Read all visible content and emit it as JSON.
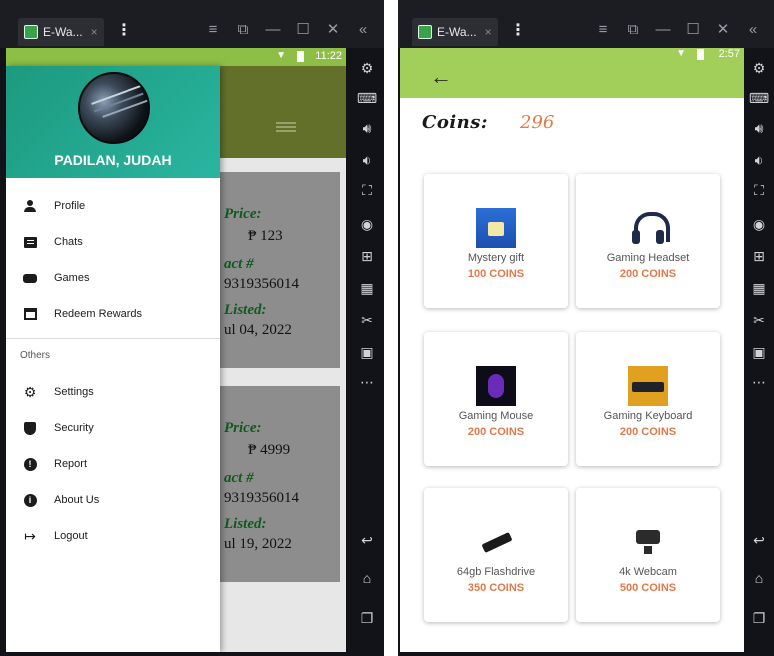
{
  "left_window": {
    "tab_title": "E-Wa...",
    "tab_close": "×",
    "status_time": "11:22",
    "drawer": {
      "user_name": "PADILAN, JUDAH",
      "items": [
        {
          "label": "Profile",
          "icon": "person-icon"
        },
        {
          "label": "Chats",
          "icon": "chat-icon"
        },
        {
          "label": "Games",
          "icon": "gamepad-icon"
        },
        {
          "label": "Redeem Rewards",
          "icon": "gift-icon"
        }
      ],
      "section_label": "Others",
      "other_items": [
        {
          "label": "Settings",
          "icon": "gear-icon"
        },
        {
          "label": "Security",
          "icon": "shield-icon"
        },
        {
          "label": "Report",
          "icon": "alert-icon"
        },
        {
          "label": "About Us",
          "icon": "info-icon"
        },
        {
          "label": "Logout",
          "icon": "logout-icon"
        }
      ]
    },
    "background_listings": [
      {
        "price_label": "Price:",
        "price": "₱ 123",
        "contact_label": "act #",
        "contact": "9319356014",
        "listed_label": "Listed:",
        "listed": "ul 04, 2022"
      },
      {
        "price_label": "Price:",
        "price": "₱ 4999",
        "contact_label": "act #",
        "contact": "9319356014",
        "listed_label": "Listed:",
        "listed": "ul 19, 2022"
      }
    ]
  },
  "right_window": {
    "tab_title": "E-Wa...",
    "tab_close": "×",
    "status_time": "2:57",
    "back_icon": "back-arrow-icon",
    "coins_label": "Coins:",
    "coins_value": "296",
    "rewards": [
      {
        "name": "Mystery gift",
        "price": "100 COINS",
        "icon": "gift-icon"
      },
      {
        "name": "Gaming Headset",
        "price": "200 COINS",
        "icon": "headset-icon"
      },
      {
        "name": "Gaming Mouse",
        "price": "200 COINS",
        "icon": "mouse-icon"
      },
      {
        "name": "Gaming Keyboard",
        "price": "200 COINS",
        "icon": "keyboard-icon"
      },
      {
        "name": "64gb Flashdrive",
        "price": "350 COINS",
        "icon": "flashdrive-icon"
      },
      {
        "name": "4k Webcam",
        "price": "500 COINS",
        "icon": "webcam-icon"
      }
    ]
  },
  "colors": {
    "app_green": "#a2cf5a",
    "drawer_teal": "#2ab5a1",
    "price_orange": "#e07a4a"
  }
}
